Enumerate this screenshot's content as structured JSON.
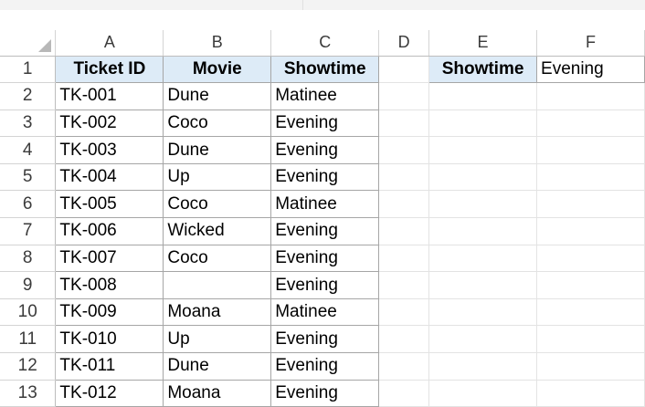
{
  "columns": [
    "A",
    "B",
    "C",
    "D",
    "E",
    "F"
  ],
  "table": {
    "headers": [
      "Ticket ID",
      "Movie",
      "Showtime"
    ],
    "rows": [
      [
        "TK-001",
        "Dune",
        "Matinee"
      ],
      [
        "TK-002",
        "Coco",
        "Evening"
      ],
      [
        "TK-003",
        "Dune",
        "Evening"
      ],
      [
        "TK-004",
        "Up",
        "Evening"
      ],
      [
        "TK-005",
        "Coco",
        "Matinee"
      ],
      [
        "TK-006",
        "Wicked",
        "Evening"
      ],
      [
        "TK-007",
        "Coco",
        "Evening"
      ],
      [
        "TK-008",
        "",
        "Evening"
      ],
      [
        "TK-009",
        "Moana",
        "Matinee"
      ],
      [
        "TK-010",
        "Up",
        "Evening"
      ],
      [
        "TK-011",
        "Dune",
        "Evening"
      ],
      [
        "TK-012",
        "Moana",
        "Evening"
      ]
    ]
  },
  "criteria": {
    "label": "Showtime",
    "value": "Evening"
  },
  "row_numbers": [
    "1",
    "2",
    "3",
    "4",
    "5",
    "6",
    "7",
    "8",
    "9",
    "10",
    "11",
    "12",
    "13"
  ],
  "colors": {
    "header_fill": "#ddebf7",
    "cell_border": "#a6a6a6",
    "gridline": "#e3e3e3"
  }
}
